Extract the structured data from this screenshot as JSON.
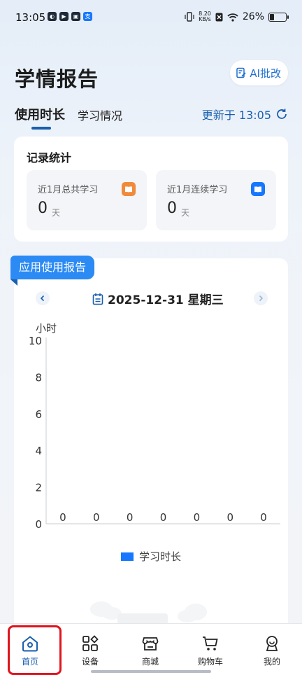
{
  "status_bar": {
    "time": "13:05",
    "net_speed_value": "8.20",
    "net_speed_unit": "KB/s",
    "battery": "26%",
    "battery_level": 0.26
  },
  "header": {
    "title": "学情报告",
    "ai_button": "AI批改"
  },
  "tabs": {
    "active": "使用时长",
    "other": "学习情况",
    "updated": "更新于 13:05"
  },
  "stats": {
    "title": "记录统计",
    "items": [
      {
        "label": "近1月总共学习",
        "value": "0",
        "unit": "天",
        "icon": "book-icon",
        "color": "#f08a3c"
      },
      {
        "label": "近1月连续学习",
        "value": "0",
        "unit": "天",
        "icon": "book-open-icon",
        "color": "#1677ff"
      }
    ]
  },
  "report": {
    "ribbon": "应用使用报告",
    "date": "2025-12-31 星期三",
    "legend": "学习时长"
  },
  "chart_data": {
    "type": "bar",
    "ylabel": "小时",
    "ylim": [
      0,
      10
    ],
    "yticks": [
      "0",
      "2",
      "4",
      "6",
      "8",
      "10"
    ],
    "series": [
      {
        "name": "学习时长",
        "values": [
          0,
          0,
          0,
          0,
          0,
          0,
          0
        ]
      }
    ],
    "data_labels": [
      "0",
      "0",
      "0",
      "0",
      "0",
      "0",
      "0"
    ],
    "color": "#1677ff"
  },
  "tabbar": {
    "items": [
      {
        "label": "首页",
        "icon": "home-icon"
      },
      {
        "label": "设备",
        "icon": "apps-icon"
      },
      {
        "label": "商城",
        "icon": "store-icon"
      },
      {
        "label": "购物车",
        "icon": "cart-icon"
      },
      {
        "label": "我的",
        "icon": "profile-icon"
      }
    ]
  }
}
